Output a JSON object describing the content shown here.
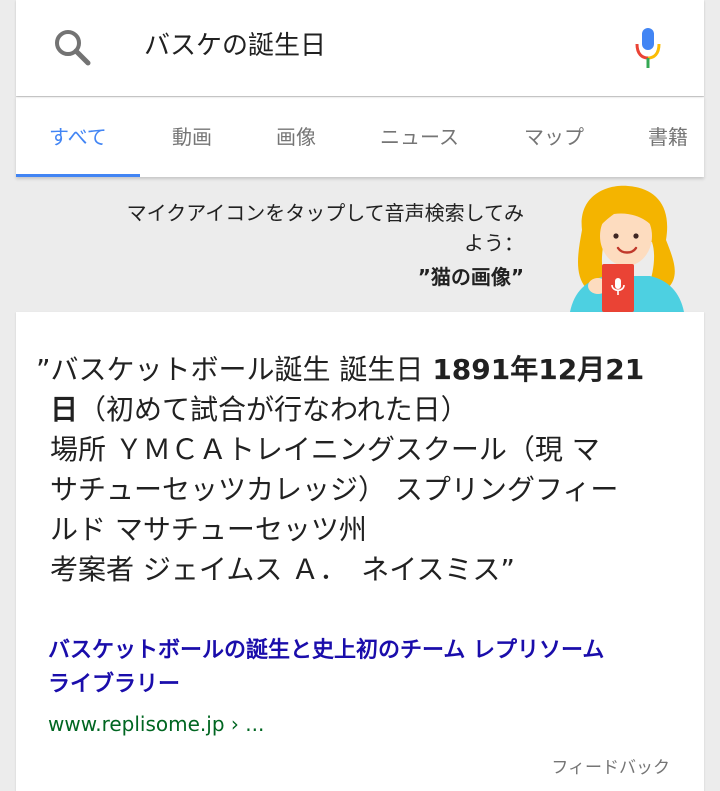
{
  "search": {
    "query": "バスケの誕生日",
    "search_icon": "search-icon",
    "mic_icon": "mic-icon"
  },
  "tabs": [
    {
      "label": "すべて",
      "active": true
    },
    {
      "label": "動画",
      "active": false
    },
    {
      "label": "画像",
      "active": false
    },
    {
      "label": "ニュース",
      "active": false
    },
    {
      "label": "マップ",
      "active": false
    },
    {
      "label": "書籍",
      "active": false
    }
  ],
  "voice_promo": {
    "text_line1": "マイクアイコンをタップして音声検索してみ",
    "text_line2": "よう：",
    "example": "”猫の画像”",
    "illustration": "woman-with-mic-illustration"
  },
  "answer": {
    "line1_prefix": "”バスケットボール誕生 誕生日 ",
    "line1_bold": "1891年12月21",
    "line2_bold": "日",
    "line2_rest": "（初めて試合が行なわれた日）",
    "line3": "場所 ＹＭＣＡトレイニングスクール（現 マ",
    "line4": "サチューセッツカレッジ） スプリングフィー",
    "line5": "ルド マサチューセッツ州",
    "line6": "考案者 ジェイムス Ａ．　ネイスミス”",
    "result_title_line1": "バスケットボールの誕生と史上初のチーム レプリソーム",
    "result_title_line2": "ライブラリー",
    "result_url": "www.replisome.jp › ...",
    "feedback": "フィードバック"
  },
  "colors": {
    "accent_blue": "#4285f4",
    "link_blue": "#1a0dab",
    "url_green": "#006621",
    "mic_red": "#ea4335",
    "mic_yellow": "#fbbc05",
    "mic_green": "#34a853",
    "background": "#ececec"
  }
}
